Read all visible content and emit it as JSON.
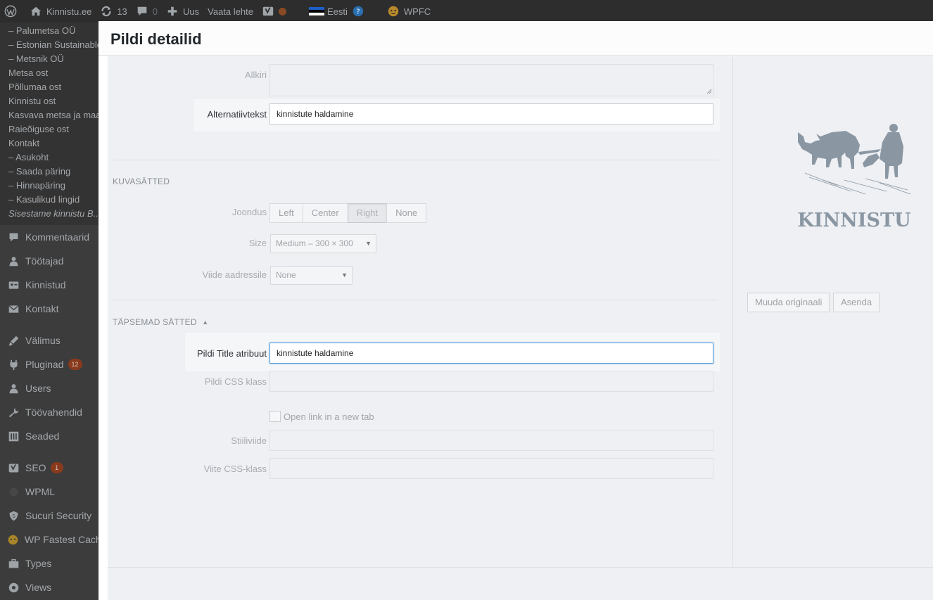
{
  "admin_bar": {
    "site_name": "Kinnistu.ee",
    "updates_count": "13",
    "comments_count": "0",
    "new_label": "Uus",
    "view_label": "Vaata lehte",
    "language_label": "Eesti",
    "cache_label": "WPFC"
  },
  "side_menu": {
    "sub_items": [
      "– Palumetsa OÜ",
      "– Estonian Sustainable",
      "– Metsnik OÜ",
      "Metsa ost",
      "Põllumaa ost",
      "Kinnistu ost",
      "Kasvava metsa ja maa...",
      "Raieõiguse ost",
      "Kontakt",
      "– Asukoht",
      "– Saada päring",
      "– Hinnapäring",
      "– Kasulikud lingid",
      "Sisestame kinnistu B..."
    ],
    "items": [
      {
        "label": "Kommentaarid",
        "icon": "comment-icon"
      },
      {
        "label": "Töötajad",
        "icon": "user-tie-icon"
      },
      {
        "label": "Kinnistud",
        "icon": "id-card-icon"
      },
      {
        "label": "Kontakt",
        "icon": "mail-icon"
      }
    ],
    "items2": [
      {
        "label": "Välimus",
        "icon": "brush-icon"
      },
      {
        "label": "Pluginad",
        "icon": "plugin-icon",
        "badge": "12"
      },
      {
        "label": "Users",
        "icon": "users-icon"
      },
      {
        "label": "Töövahendid",
        "icon": "wrench-icon"
      },
      {
        "label": "Seaded",
        "icon": "settings-icon"
      }
    ],
    "items3": [
      {
        "label": "SEO",
        "icon": "yoast-icon",
        "badge": "1"
      },
      {
        "label": "WPML",
        "icon": "wpml-icon"
      },
      {
        "label": "Sucuri Security",
        "icon": "shield-icon"
      },
      {
        "label": "WP Fastest Cache",
        "icon": "cheetah-icon"
      },
      {
        "label": "Types",
        "icon": "briefcase-icon"
      },
      {
        "label": "Views",
        "icon": "eye-icon"
      }
    ]
  },
  "modal": {
    "title": "Pildi detailid",
    "fields": {
      "caption_label": "Allkiri",
      "caption_value": "",
      "alt_label": "Alternatiivtekst",
      "alt_value": "kinnistute haldamine"
    },
    "display_settings": {
      "section_title": "KUVASÄTTED",
      "align_label": "Joondus",
      "align_options": [
        "Left",
        "Center",
        "Right",
        "None"
      ],
      "align_selected": "Right",
      "size_label": "Size",
      "size_value": "Medium – 300 × 300",
      "link_label": "Viide aadressile",
      "link_value": "None"
    },
    "advanced": {
      "section_title": "TÄPSEMAD SÄTTED",
      "title_attr_label": "Pildi Title atribuut",
      "title_attr_value": "kinnistute haldamine",
      "css_class_label": "Pildi CSS klass",
      "css_class_value": "",
      "new_tab_label": "Open link in a new tab",
      "new_tab_checked": false,
      "link_rel_label": "Stiiliviide",
      "link_rel_value": "",
      "link_css_label": "Viite CSS-klass",
      "link_css_value": ""
    },
    "sidebar": {
      "logo_text": "KINNISTU",
      "edit_original_label": "Muuda originaali",
      "replace_label": "Asenda"
    }
  }
}
